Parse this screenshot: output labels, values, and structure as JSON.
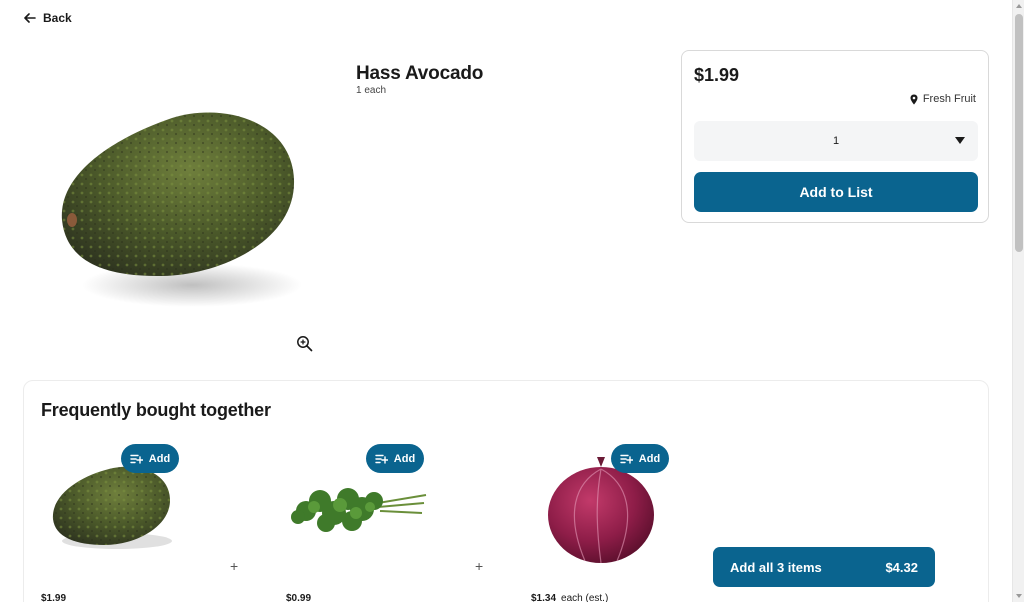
{
  "nav": {
    "back_label": "Back"
  },
  "product": {
    "name": "Hass Avocado",
    "unit": "1 each",
    "price": "$1.99",
    "aisle": "Fresh Fruit",
    "quantity": "1",
    "add_to_list_label": "Add to List"
  },
  "fbt": {
    "title": "Frequently bought together",
    "items": [
      {
        "name": "Hass Avocado",
        "add_label": "Add",
        "price": "$1.99",
        "price_note": ""
      },
      {
        "name": "Cilantro",
        "add_label": "Add",
        "price": "$0.99",
        "price_note": ""
      },
      {
        "name": "Red Onion",
        "add_label": "Add",
        "price": "$1.34",
        "price_note": "each (est.)"
      }
    ],
    "add_all_label": "Add all 3 items",
    "add_all_total": "$4.32"
  },
  "colors": {
    "accent": "#0a648f",
    "card_border": "#d9d9d9",
    "field_bg": "#f4f5f6"
  },
  "icons": [
    "arrow-left-icon",
    "zoom-in-icon",
    "location-pin-icon",
    "chevron-down-icon",
    "add-to-list-icon",
    "plus-icon"
  ]
}
